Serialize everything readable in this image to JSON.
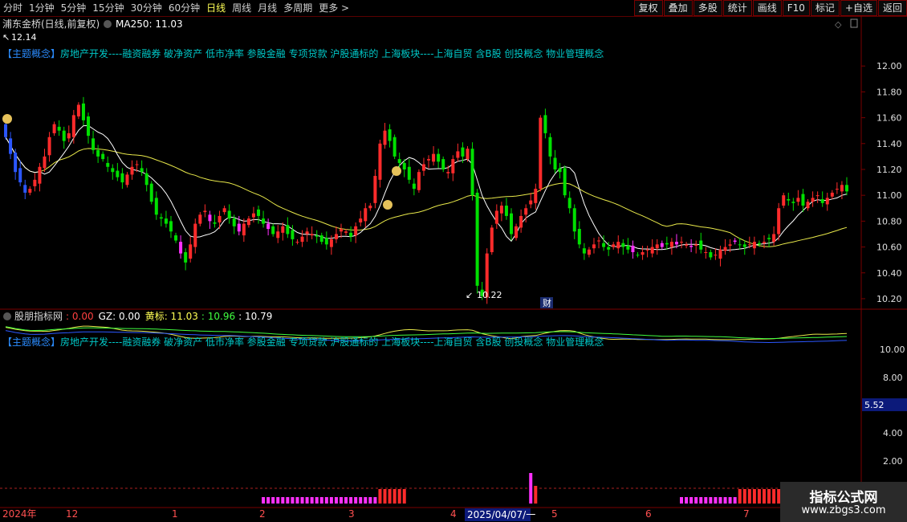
{
  "toolbar": {
    "periods": [
      "分时",
      "1分钟",
      "5分钟",
      "15分钟",
      "30分钟",
      "60分钟",
      "日线",
      "周线",
      "月线",
      "多周期",
      "更多 >"
    ],
    "active_period": "日线",
    "actions": [
      "复权",
      "叠加",
      "多股",
      "统计",
      "画线",
      "F10",
      "标记",
      "+自选",
      "返回"
    ]
  },
  "main": {
    "stock_title": "浦东金桥(日线,前复权)",
    "ma_label": "MA250: 11.03",
    "high_marker": "12.14",
    "low_marker": "10.22",
    "caifu_badge": "财",
    "concept_tag": "【主题概念】",
    "concept_text": "房地产开发----融资融券 破净资产 低市净率 参股金融 专项贷款 沪股通标的 上海板块----上海自贸 含B股 创投概念 物业管理概念",
    "price_axis": [
      "12.00",
      "11.80",
      "11.60",
      "11.40",
      "11.20",
      "11.00",
      "10.80",
      "10.60",
      "10.40",
      "10.20"
    ]
  },
  "indicator": {
    "name": "股朋指标网",
    "v1": ": 0.00",
    "gz": "GZ: 0.00",
    "hb": "黄标: 11.03",
    "v2": ": 10.96",
    "v3": ": 10.79",
    "concept_tag": "【主题概念】",
    "concept_text": "房地产开发----融资融券 破净资产 低市净率 参股金融 专项贷款 沪股通标的 上海板块----上海自贸 含B股 创投概念 物业管理概念",
    "axis": [
      "10.00",
      "8.00",
      "4.00",
      "2.00"
    ],
    "current_value": "5.52"
  },
  "timeline": {
    "labels": [
      "2024年",
      "12",
      "1",
      "2",
      "3",
      "4",
      "2025/04/07/一",
      "5",
      "6",
      "7"
    ]
  },
  "watermark": {
    "line1": "指标公式网",
    "line2": "www.zbgs3.com"
  },
  "colors": {
    "up": "#ff2b2b",
    "down": "#00e000",
    "magenta": "#ff30ff",
    "blue": "#2b57ff",
    "ma_short": "#ffffff",
    "ma_long": "#e8e84a",
    "axis": "#7a0000",
    "grid": "#3a0000",
    "concept": "#00c8c8"
  },
  "chart_data": {
    "type": "candlestick",
    "ylim": [
      10.15,
      12.2
    ],
    "closes": [
      11.45,
      11.32,
      11.18,
      11.1,
      11.02,
      11.05,
      11.12,
      11.22,
      11.3,
      11.45,
      11.55,
      11.5,
      11.42,
      11.48,
      11.62,
      11.7,
      11.58,
      11.46,
      11.35,
      11.3,
      11.28,
      11.22,
      11.18,
      11.14,
      11.1,
      11.16,
      11.22,
      11.24,
      11.18,
      11.08,
      10.95,
      10.85,
      10.82,
      10.78,
      10.72,
      10.65,
      10.55,
      10.48,
      10.62,
      10.78,
      10.85,
      10.88,
      10.8,
      10.78,
      10.84,
      10.9,
      10.82,
      10.76,
      10.72,
      10.78,
      10.82,
      10.86,
      10.84,
      10.78,
      10.74,
      10.7,
      10.72,
      10.76,
      10.7,
      10.66,
      10.64,
      10.68,
      10.72,
      10.7,
      10.68,
      10.64,
      10.62,
      10.66,
      10.7,
      10.74,
      10.72,
      10.68,
      10.76,
      10.82,
      10.9,
      10.92,
      11.15,
      11.4,
      11.5,
      11.42,
      11.3,
      11.25,
      11.2,
      11.12,
      11.05,
      11.18,
      11.24,
      11.28,
      11.32,
      11.26,
      11.2,
      11.18,
      11.28,
      11.34,
      11.3,
      11.36,
      11.0,
      10.3,
      10.22,
      10.55,
      10.75,
      10.88,
      10.92,
      10.84,
      10.7,
      10.76,
      10.84,
      10.9,
      10.96,
      11.05,
      11.6,
      11.48,
      11.3,
      11.2,
      11.18,
      11.0,
      10.9,
      10.72,
      10.62,
      10.55,
      10.58,
      10.62,
      10.65,
      10.6,
      10.58,
      10.62,
      10.64,
      10.6,
      10.58,
      10.56,
      10.54,
      10.56,
      10.58,
      10.6,
      10.62,
      10.6,
      10.62,
      10.64,
      10.62,
      10.64,
      10.62,
      10.6,
      10.62,
      10.58,
      10.56,
      10.52,
      10.54,
      10.58,
      10.6,
      10.62,
      10.64,
      10.62,
      10.6,
      10.62,
      10.64,
      10.62,
      10.64,
      10.66,
      10.7,
      10.9,
      11.0,
      10.96,
      10.94,
      10.98,
      10.92,
      10.95,
      10.98,
      11.0,
      10.94,
      10.98,
      11.02,
      11.05,
      11.08,
      11.03
    ]
  }
}
